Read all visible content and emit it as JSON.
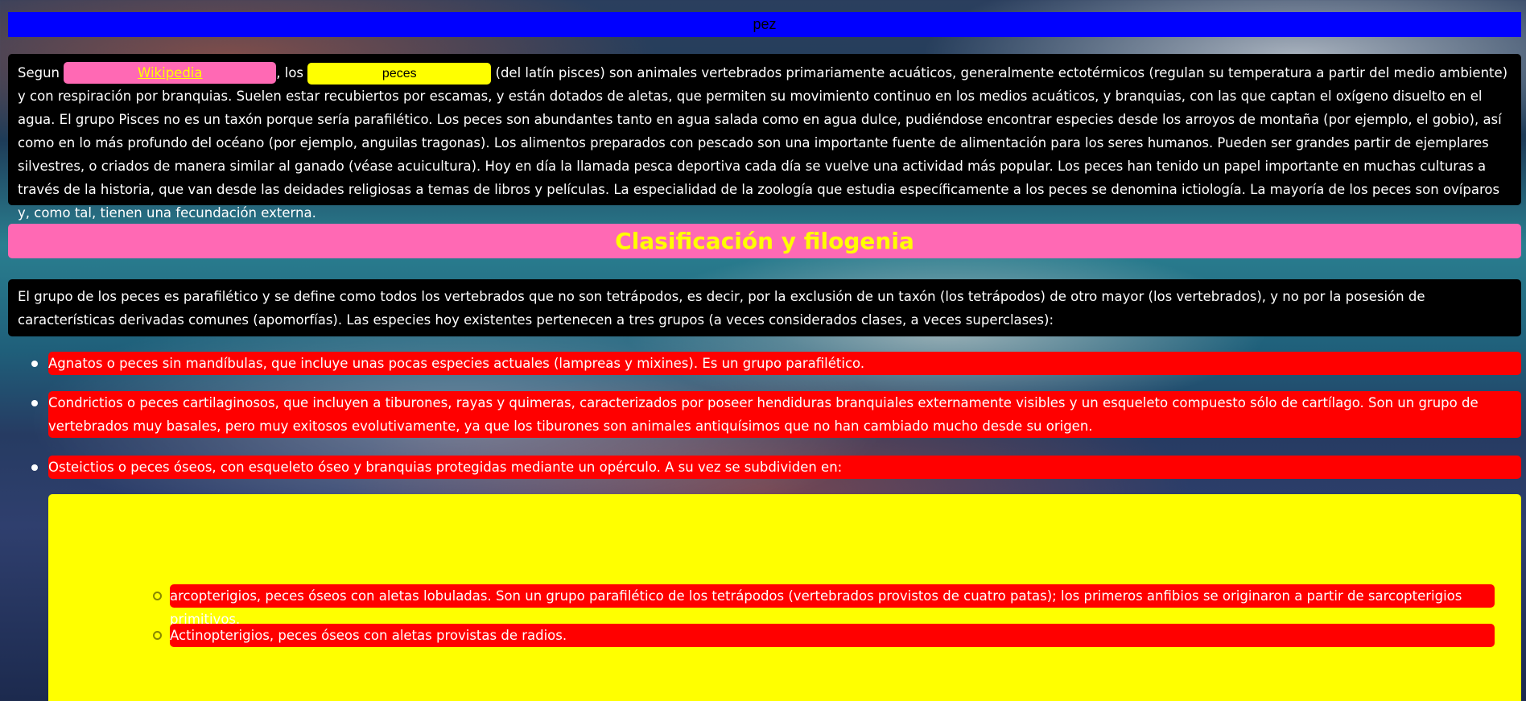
{
  "title": "pez",
  "intro": {
    "prefix": "Segun ",
    "link_label": "Wikipedia",
    "middle": ", los ",
    "highlight": "peces",
    "text": " (del latín pisces) son animales vertebrados primariamente acuáticos, generalmente ectotérmicos (regulan su temperatura a partir del medio ambiente) y con respiración por branquias. Suelen estar recubiertos por escamas, y están dotados de aletas, que permiten su movimiento continuo en los medios acuáticos, y branquias, con las que captan el oxígeno disuelto en el agua. El grupo Pisces no es un taxón porque sería parafilético. Los peces son abundantes tanto en agua salada como en agua dulce, pudiéndose encontrar especies desde los arroyos de montaña (por ejemplo, el gobio), así como en lo más profundo del océano (por ejemplo, anguilas tragonas). Los alimentos preparados con pescado son una importante fuente de alimentación para los seres humanos. Pueden ser grandes partir de ejemplares silvestres, o criados de manera similar al ganado (véase acuicultura). Hoy en día la llamada pesca deportiva cada día se vuelve una actividad más popular. Los peces han tenido un papel importante en muchas culturas a través de la historia, que van desde las deidades religiosas a temas de libros y películas. La especialidad de la zoología que estudia específicamente a los peces se denomina ictiología. La mayoría de los peces son ovíparos y, como tal, tienen una fecundación externa."
  },
  "section_heading": "Clasificación y filogenia",
  "paragraph2": "El grupo de los peces es parafilético y se define como todos los vertebrados que no son tetrápodos, es decir, por la exclusión de un taxón (los tetrápodos) de otro mayor (los vertebrados), y no por la posesión de características derivadas comunes (apomorfías). Las especies hoy existentes pertenecen a tres grupos (a veces considerados clases, a veces superclases):",
  "list": [
    "Agnatos o peces sin mandíbulas, que incluye unas pocas especies actuales (lampreas y mixines). Es un grupo parafilético.",
    "Condrictios o peces cartilaginosos, que incluyen a tiburones, rayas y quimeras, caracterizados por poseer hendiduras branquiales externamente visibles y un esqueleto compuesto sólo de cartílago. Son un grupo de vertebrados muy basales, pero muy exitosos evolutivamente, ya que los tiburones son animales antiquísimos que no han cambiado mucho desde su origen.",
    "Osteictios o peces óseos, con esqueleto óseo y branquias protegidas mediante un opérculo. A su vez se subdividen en:"
  ],
  "sublist": [
    "arcopterigios, peces óseos con aletas lobuladas. Son un grupo parafilético de los tetrápodos (vertebrados provistos de cuatro patas); los primeros anfibios se originaron a partir de sarcopterigios primitivos.",
    "Actinopterigios, peces óseos con aletas provistas de radios."
  ],
  "colors": {
    "title_bar": "#0000ff",
    "card_black": "#000000",
    "pink": "#ff69b4",
    "yellow": "#ffff00",
    "red": "#ff0000"
  }
}
